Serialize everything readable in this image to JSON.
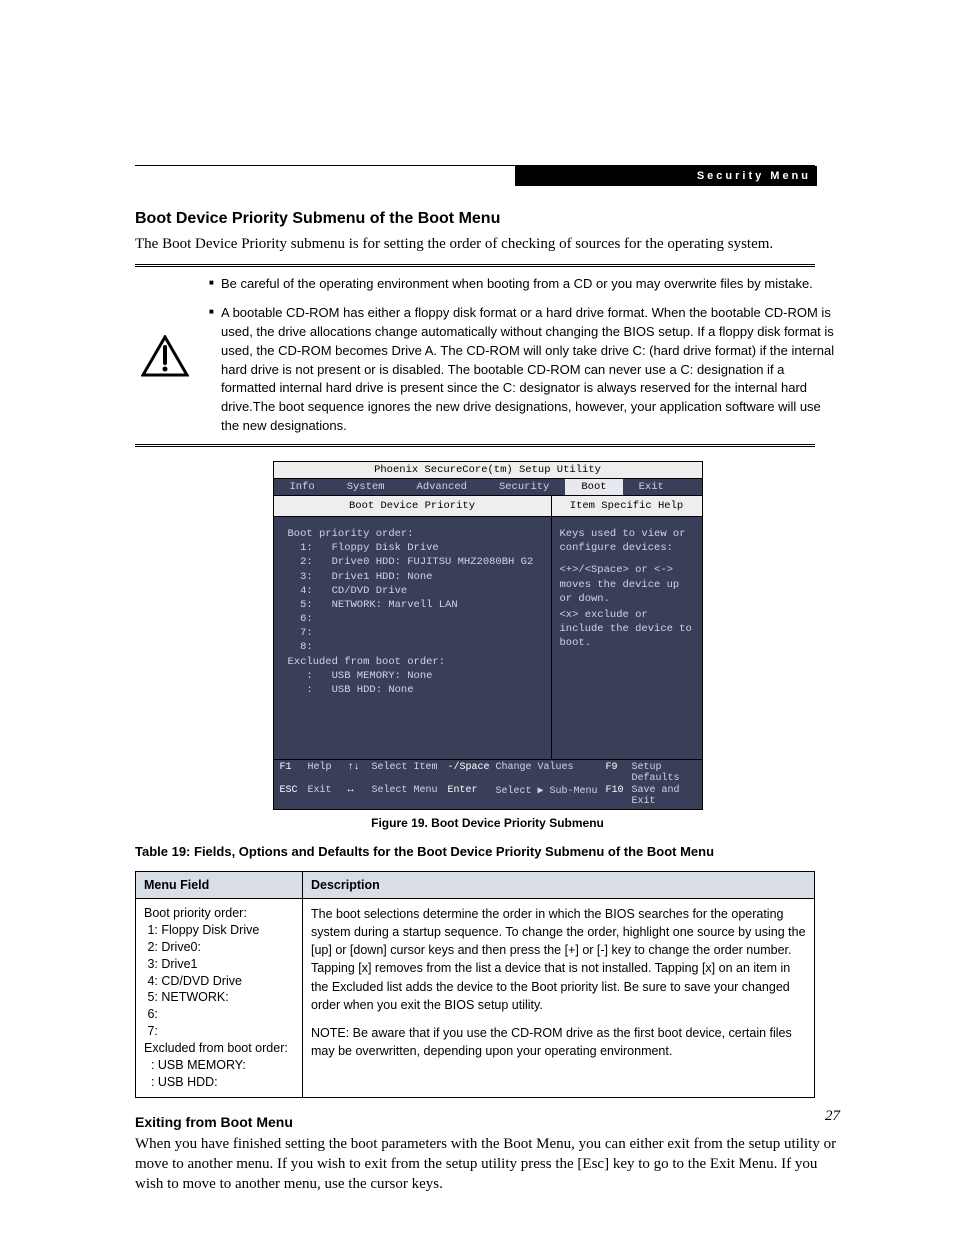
{
  "header_bar": "Security Menu",
  "section_heading": "Boot Device Priority Submenu of the Boot Menu",
  "intro_para": "The Boot Device Priority submenu is for setting the order of checking of sources for the operating system.",
  "notice": {
    "bullet1": "Be careful of the operating environment when booting from a CD or you may overwrite files by mistake.",
    "bullet2": "A bootable CD-ROM has either a floppy disk format or a hard drive format. When the bootable CD-ROM is used, the drive allocations change automatically without changing the BIOS setup. If a floppy disk format is used, the CD-ROM becomes Drive A. The CD-ROM will only take drive C: (hard drive format) if the internal hard drive is not present or is disabled. The bootable CD-ROM can never use a C: designation if a formatted internal hard drive is present since the C: designator is always reserved for the internal hard drive.The boot sequence ignores the new drive designations, however, your application software will use the new designations."
  },
  "bios": {
    "title": "Phoenix SecureCore(tm) Setup Utility",
    "tabs": [
      "Info",
      "System",
      "Advanced",
      "Security",
      "Boot",
      "Exit"
    ],
    "active_tab_index": 4,
    "left_heading": "Boot Device Priority",
    "right_heading": "Item Specific Help",
    "boot_list_label": "Boot priority order:",
    "boot_list": [
      "1:   Floppy Disk Drive",
      "2:   Drive0 HDD: FUJITSU MHZ2080BH G2",
      "3:   Drive1 HDD: None",
      "4:   CD/DVD Drive",
      "5:   NETWORK: Marvell LAN",
      "6:",
      "7:",
      "8:"
    ],
    "excluded_label": "Excluded from boot order:",
    "excluded": [
      " :   USB MEMORY: None",
      " :   USB HDD: None"
    ],
    "help_lines": [
      "Keys used to view or configure devices:",
      "<+>/<Space> or <-> moves the device up or down.",
      "<x> exclude or include the device to boot."
    ],
    "keys": {
      "f1": "F1",
      "f1l": "Help",
      "arrud": "↑↓",
      "arrudl": "Select Item",
      "pm": "-/Space",
      "pml": "Change Values",
      "f9": "F9",
      "f9l": "Setup Defaults",
      "esc": "ESC",
      "escl": "Exit",
      "arrlr": "↔",
      "arrlrl": "Select Menu",
      "ent": "Enter",
      "entl": "Select ▶ Sub-Menu",
      "f10": "F10",
      "f10l": "Save and Exit"
    }
  },
  "figure_caption": "Figure 19.  Boot Device Priority Submenu",
  "table_caption": "Table 19: Fields, Options and Defaults for the Boot Device Priority Submenu of the Boot Menu",
  "table": {
    "h1": "Menu Field",
    "h2": "Description",
    "mf_lines": [
      "Boot priority order:",
      " 1: Floppy Disk Drive",
      " 2: Drive0:",
      " 3: Drive1",
      " 4: CD/DVD Drive",
      " 5: NETWORK:",
      " 6:",
      " 7:",
      "Excluded from boot order:",
      "  : USB MEMORY:",
      "  : USB HDD:"
    ],
    "desc_main": "The boot selections determine the order in which the BIOS searches for the operating system during a startup sequence. To change the order, highlight one source by using the [up] or [down] cursor keys and then press the [+] or [-] key to change the order number. Tapping [x] removes from the list a device that is not installed. Tapping [x] on an item in the Excluded list adds the device to the Boot priority list. Be sure to save your changed order when you exit the BIOS setup utility.",
    "desc_note": "NOTE: Be aware that if you use the CD-ROM drive as the first boot device, certain files may be overwritten, depending upon your operating environment."
  },
  "sub_heading": "Exiting from Boot Menu",
  "sub_para": "When you have finished setting the boot parameters with the Boot Menu, you can either exit from the setup utility or move to another menu. If you wish to exit from the setup utility press the [Esc] key to go to the Exit Menu. If you wish to move to another menu, use the cursor keys.",
  "page_number": "27"
}
